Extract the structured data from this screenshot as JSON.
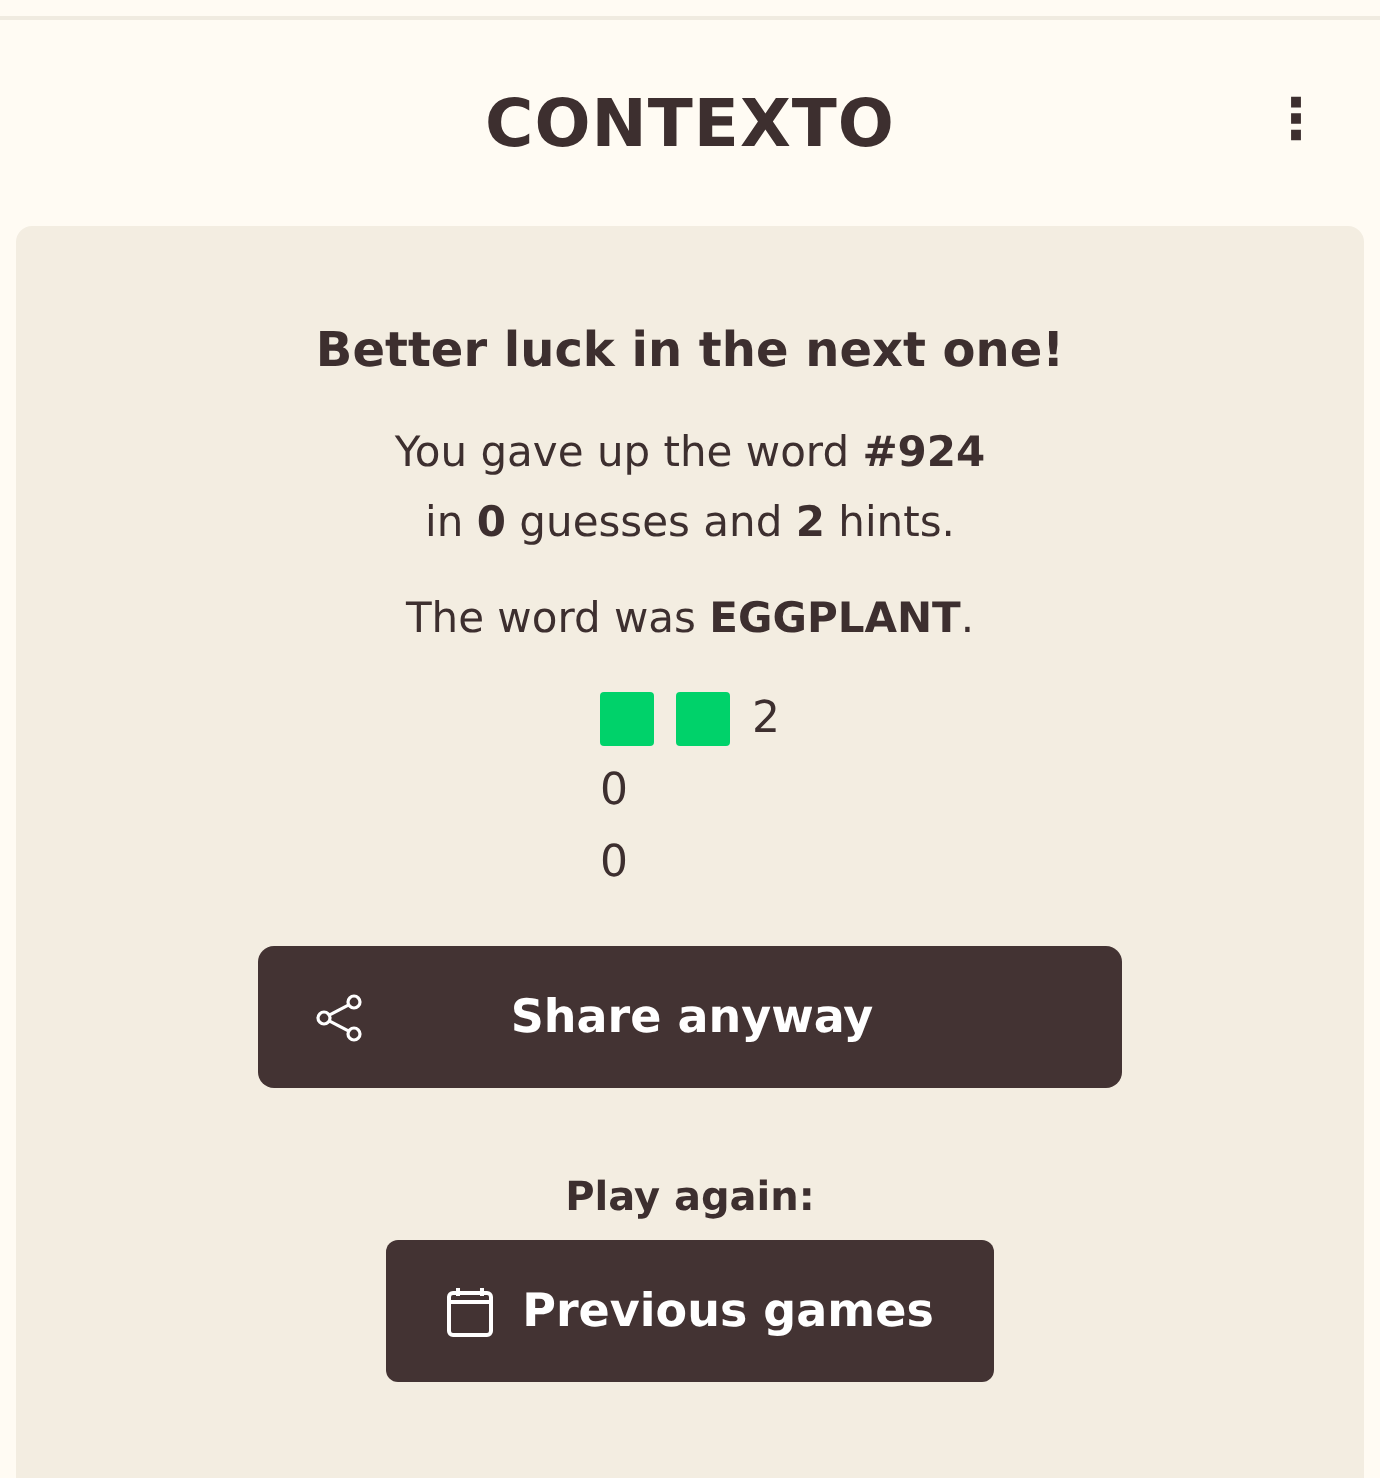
{
  "header": {
    "title": "CONTEXTO",
    "menu_icon": "⋮"
  },
  "result": {
    "heading": "Better luck in the next one!",
    "summary_lines": [
      "You gave up the word **#924**",
      "in **0** guesses and **2** hints."
    ],
    "answer": "The word was **EGGPLANT**.",
    "rows": [
      {
        "squares": [
          {
            "color": "#00d26a"
          },
          {
            "color": "#00d26a"
          }
        ],
        "count": "2"
      },
      {
        "count": "0"
      },
      {
        "count": "0"
      }
    ],
    "share_button": "Share anyway",
    "play_again_label": "Play again:",
    "previous_button": "Previous games"
  }
}
